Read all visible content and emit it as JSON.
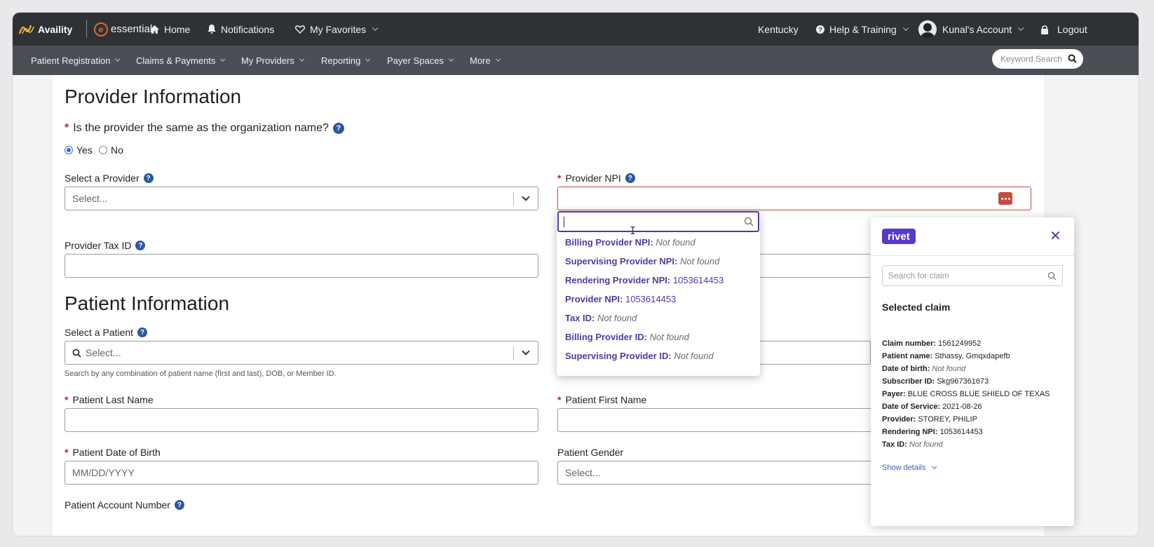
{
  "topbar": {
    "brand": "Availity",
    "essentials": "essentials",
    "home": "Home",
    "notifications": "Notifications",
    "favorites": "My Favorites",
    "state": "Kentucky",
    "help": "Help & Training",
    "account": "Kunal's Account",
    "logout": "Logout"
  },
  "nav": {
    "items": [
      "Patient Registration",
      "Claims & Payments",
      "My Providers",
      "Reporting",
      "Payer Spaces",
      "More"
    ],
    "search_placeholder": "Keyword Search"
  },
  "provider": {
    "heading": "Provider Information",
    "same_question": "Is the provider the same as the organization name?",
    "yes": "Yes",
    "no": "No",
    "yes_selected": true,
    "select_label": "Select a Provider",
    "select_placeholder": "Select...",
    "npi_label": "Provider NPI",
    "tax_label": "Provider Tax ID"
  },
  "dropdown": {
    "items": [
      {
        "label": "Billing Provider NPI:",
        "value": "Not found",
        "found": false
      },
      {
        "label": "Supervising Provider NPI:",
        "value": "Not found",
        "found": false
      },
      {
        "label": "Rendering Provider NPI:",
        "value": "1053614453",
        "found": true
      },
      {
        "label": "Provider NPI:",
        "value": "1053614453",
        "found": true
      },
      {
        "label": "Tax ID:",
        "value": "Not found",
        "found": false
      },
      {
        "label": "Billing Provider ID:",
        "value": "Not found",
        "found": false
      },
      {
        "label": "Supervising Provider ID:",
        "value": "Not found",
        "found": false
      }
    ]
  },
  "patient": {
    "heading": "Patient Information",
    "select_label": "Select a Patient",
    "select_placeholder": "Select...",
    "hint": "Search by any combination of patient name (first and last), DOB, or Member ID.",
    "last_name_label": "Patient Last Name",
    "first_name_label": "Patient First Name",
    "dob_label": "Patient Date of Birth",
    "dob_placeholder": "MM/DD/YYYY",
    "gender_label": "Patient Gender",
    "gender_placeholder": "Select...",
    "account_label": "Patient Account Number"
  },
  "rivet": {
    "logo": "rivet",
    "search_placeholder": "Search for claim",
    "title": "Selected claim",
    "rows": [
      {
        "k": "Claim number:",
        "v": "1561249952",
        "found": true
      },
      {
        "k": "Patient name:",
        "v": "Sthassy, Gmqxdapefb",
        "found": true
      },
      {
        "k": "Date of birth:",
        "v": "Not found",
        "found": false
      },
      {
        "k": "Subscriber ID:",
        "v": "Skg967361673",
        "found": true
      },
      {
        "k": "Payer:",
        "v": "BLUE CROSS BLUE SHIELD OF TEXAS",
        "found": true
      },
      {
        "k": "Date of Service:",
        "v": "2021-08-26",
        "found": true
      },
      {
        "k": "Provider:",
        "v": "STOREY, PHILIP",
        "found": true
      },
      {
        "k": "Rendering NPI:",
        "v": "1053614453",
        "found": true
      },
      {
        "k": "Tax ID:",
        "v": "Not found",
        "found": false
      }
    ],
    "show_details": "Show details"
  }
}
